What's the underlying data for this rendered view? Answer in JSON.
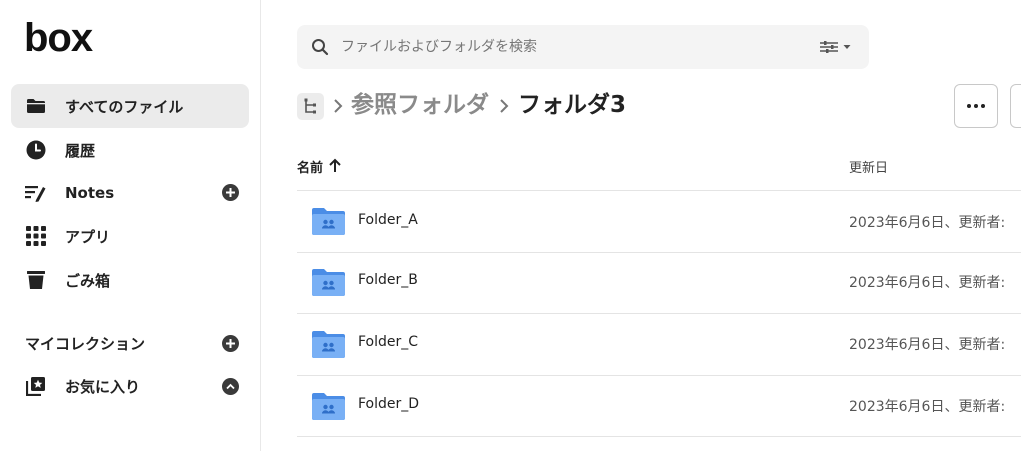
{
  "brand": {
    "logo": "box"
  },
  "sidebar": {
    "items": [
      {
        "label": "すべてのファイル",
        "icon": "folder-icon",
        "active": true
      },
      {
        "label": "履歴",
        "icon": "clock-icon"
      },
      {
        "label": "Notes",
        "icon": "notes-icon"
      },
      {
        "label": "アプリ",
        "icon": "apps-grid-icon"
      },
      {
        "label": "ごみ箱",
        "icon": "trash-icon"
      }
    ],
    "collections_label": "マイコレクション",
    "favorites_label": "お気に入り"
  },
  "search": {
    "placeholder": "ファイルおよびフォルダを検索"
  },
  "breadcrumb": {
    "items": [
      "参照フォルダ",
      "フォルダ3"
    ]
  },
  "table": {
    "columns": {
      "name": "名前",
      "modified": "更新日"
    },
    "rows": [
      {
        "name": "Folder_A",
        "modified": "2023年6月6日、更新者:"
      },
      {
        "name": "Folder_B",
        "modified": "2023年6月6日、更新者:"
      },
      {
        "name": "Folder_C",
        "modified": "2023年6月6日、更新者:"
      },
      {
        "name": "Folder_D",
        "modified": "2023年6月6日、更新者:"
      }
    ]
  },
  "colors": {
    "accent_folder": "#5f9bf0",
    "active_bg": "#ebebeb",
    "text": "#222222"
  }
}
